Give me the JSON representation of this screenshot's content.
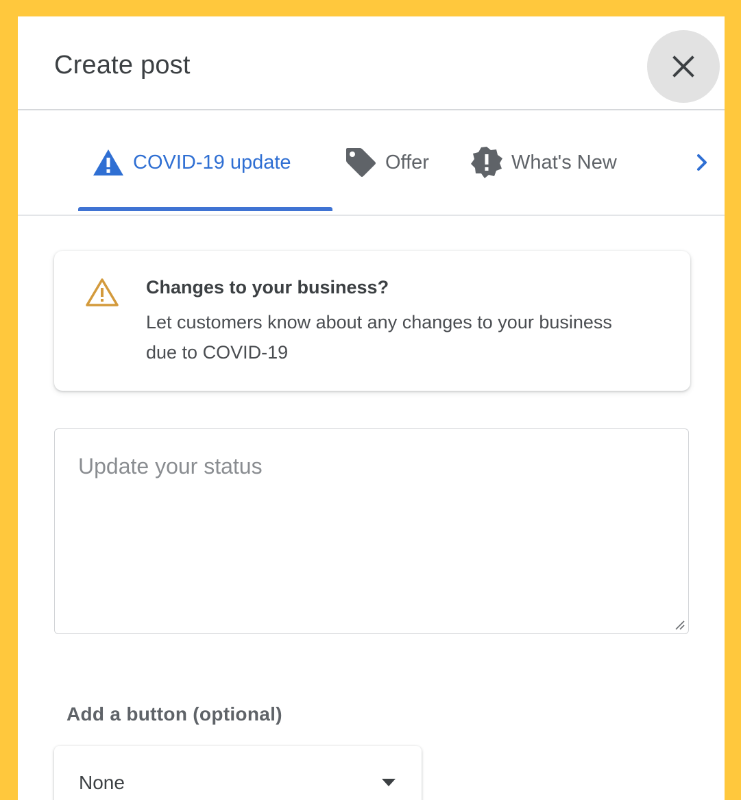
{
  "dialog": {
    "title": "Create post",
    "close_icon": "close-icon"
  },
  "tabs": [
    {
      "label": "COVID-19 update",
      "icon": "warning-icon",
      "active": true
    },
    {
      "label": "Offer",
      "icon": "tag-icon",
      "active": false
    },
    {
      "label": "What's New",
      "icon": "alert-badge-icon",
      "active": false
    }
  ],
  "tab_scroll_icon": "chevron-right-icon",
  "info_card": {
    "icon": "warning-outline-icon",
    "title": "Changes to your business?",
    "text": "Let customers know about any changes to your business due to COVID-19"
  },
  "status_input": {
    "placeholder": "Update your status",
    "value": ""
  },
  "button_section": {
    "label": "Add a button (optional)",
    "selected": "None",
    "arrow_icon": "dropdown-arrow-icon"
  },
  "colors": {
    "accent": "#2f6fd3",
    "frame": "#FFC83D",
    "warning": "#d39a3c"
  }
}
